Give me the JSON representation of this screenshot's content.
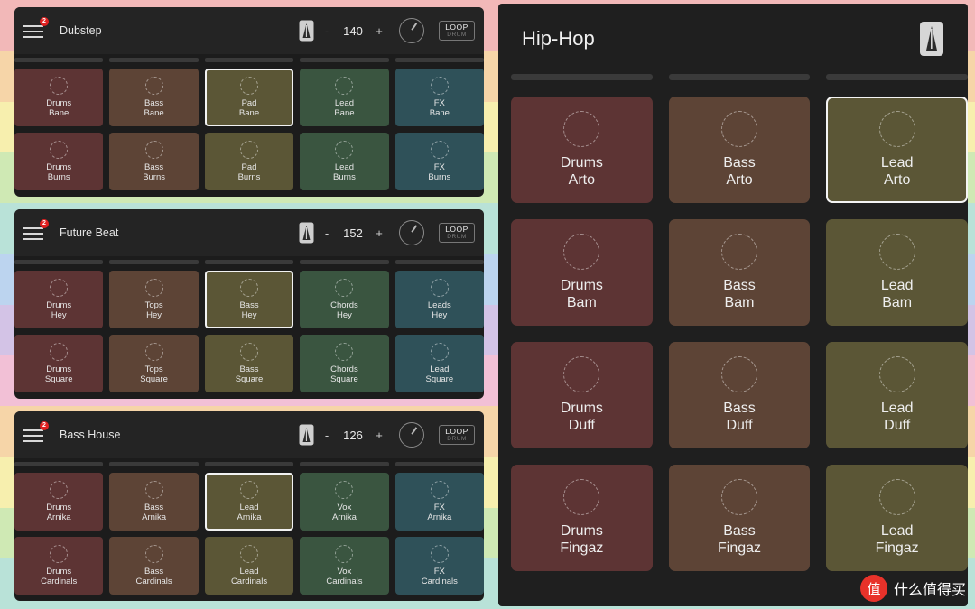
{
  "background": {
    "stripes": [
      "#f2b8b8",
      "#f6d5a8",
      "#f7efae",
      "#cfe9b4",
      "#b9e2d8",
      "#bcd4ef",
      "#d3c3e6",
      "#f2c0d6",
      "#f6d5a8",
      "#f7efae",
      "#cfe9b4",
      "#b9e2d8"
    ]
  },
  "left_panel": {
    "projects": [
      {
        "name": "Dubstep",
        "badge": "2",
        "bpm": "140",
        "minus": "-",
        "plus": "+",
        "loop_label": "LOOP",
        "loop_sub": "DRUM",
        "columns": [
          {
            "color": "#5d3434",
            "clips": [
              {
                "label": "Drums\nBane",
                "selected": false
              },
              {
                "label": "Drums\nBurns",
                "selected": false
              }
            ]
          },
          {
            "color": "#5d4436",
            "clips": [
              {
                "label": "Bass\nBane",
                "selected": false
              },
              {
                "label": "Bass\nBurns",
                "selected": false
              }
            ]
          },
          {
            "color": "#5b5636",
            "clips": [
              {
                "label": "Pad\nBane",
                "selected": true
              },
              {
                "label": "Pad\nBurns",
                "selected": false
              }
            ]
          },
          {
            "color": "#3a5540",
            "clips": [
              {
                "label": "Lead\nBane",
                "selected": false
              },
              {
                "label": "Lead\nBurns",
                "selected": false
              }
            ]
          },
          {
            "color": "#2f5159",
            "clips": [
              {
                "label": "FX\nBane",
                "selected": false
              },
              {
                "label": "FX\nBurns",
                "selected": false
              }
            ]
          }
        ]
      },
      {
        "name": "Future Beat",
        "badge": "2",
        "bpm": "152",
        "minus": "-",
        "plus": "+",
        "loop_label": "LOOP",
        "loop_sub": "DRUM",
        "columns": [
          {
            "color": "#5d3434",
            "clips": [
              {
                "label": "Drums\nHey",
                "selected": false
              },
              {
                "label": "Drums\nSquare",
                "selected": false
              }
            ]
          },
          {
            "color": "#5d4436",
            "clips": [
              {
                "label": "Tops\nHey",
                "selected": false
              },
              {
                "label": "Tops\nSquare",
                "selected": false
              }
            ]
          },
          {
            "color": "#5b5636",
            "clips": [
              {
                "label": "Bass\nHey",
                "selected": true
              },
              {
                "label": "Bass\nSquare",
                "selected": false
              }
            ]
          },
          {
            "color": "#3a5540",
            "clips": [
              {
                "label": "Chords\nHey",
                "selected": false
              },
              {
                "label": "Chords\nSquare",
                "selected": false
              }
            ]
          },
          {
            "color": "#2f5159",
            "clips": [
              {
                "label": "Leads\nHey",
                "selected": false
              },
              {
                "label": "Lead\nSquare",
                "selected": false
              }
            ]
          }
        ]
      },
      {
        "name": "Bass House",
        "badge": "2",
        "bpm": "126",
        "minus": "-",
        "plus": "+",
        "loop_label": "LOOP",
        "loop_sub": "DRUM",
        "columns": [
          {
            "color": "#5d3434",
            "clips": [
              {
                "label": "Drums\nArnika",
                "selected": false
              },
              {
                "label": "Drums\nCardinals",
                "selected": false
              }
            ]
          },
          {
            "color": "#5d4436",
            "clips": [
              {
                "label": "Bass\nArnika",
                "selected": false
              },
              {
                "label": "Bass\nCardinals",
                "selected": false
              }
            ]
          },
          {
            "color": "#5b5636",
            "clips": [
              {
                "label": "Lead\nArnika",
                "selected": true
              },
              {
                "label": "Lead\nCardinals",
                "selected": false
              }
            ]
          },
          {
            "color": "#3a5540",
            "clips": [
              {
                "label": "Vox\nArnika",
                "selected": false
              },
              {
                "label": "Vox\nCardinals",
                "selected": false
              }
            ]
          },
          {
            "color": "#2f5159",
            "clips": [
              {
                "label": "FX\nArnika",
                "selected": false
              },
              {
                "label": "FX\nCardinals",
                "selected": false
              }
            ]
          }
        ]
      }
    ]
  },
  "right_panel": {
    "title": "Hip-Hop",
    "columns": [
      {
        "color": "#5d3434",
        "clips": [
          {
            "label": "Drums\nArto",
            "selected": false
          },
          {
            "label": "Drums\nBam",
            "selected": false
          },
          {
            "label": "Drums\nDuff",
            "selected": false
          },
          {
            "label": "Drums\nFingaz",
            "selected": false
          }
        ]
      },
      {
        "color": "#5d4436",
        "clips": [
          {
            "label": "Bass\nArto",
            "selected": false
          },
          {
            "label": "Bass\nBam",
            "selected": false
          },
          {
            "label": "Bass\nDuff",
            "selected": false
          },
          {
            "label": "Bass\nFingaz",
            "selected": false
          }
        ]
      },
      {
        "color": "#5b5636",
        "clips": [
          {
            "label": "Lead\nArto",
            "selected": true
          },
          {
            "label": "Lead\nBam",
            "selected": false
          },
          {
            "label": "Lead\nDuff",
            "selected": false
          },
          {
            "label": "Lead\nFingaz",
            "selected": false
          }
        ]
      }
    ]
  },
  "watermark": {
    "badge": "值",
    "text": "什么值得买"
  }
}
